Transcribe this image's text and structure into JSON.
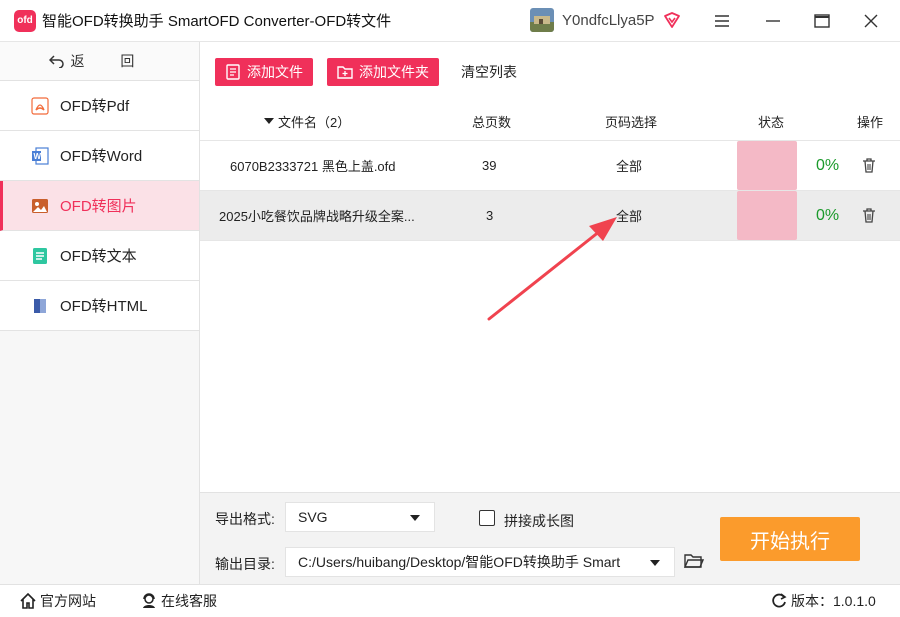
{
  "window": {
    "title": "智能OFD转换助手 SmartOFD Converter-OFD转文件",
    "logo_text": "ofd",
    "username": "Y0ndfcLlya5P"
  },
  "sidebar": {
    "back_label": "返 回",
    "items": [
      {
        "label": "OFD转Pdf",
        "icon": "pdf-icon"
      },
      {
        "label": "OFD转Word",
        "icon": "word-icon"
      },
      {
        "label": "OFD转图片",
        "icon": "image-icon",
        "active": true
      },
      {
        "label": "OFD转文本",
        "icon": "text-icon"
      },
      {
        "label": "OFD转HTML",
        "icon": "html-icon"
      }
    ]
  },
  "toolbar": {
    "add_file": "添加文件",
    "add_folder": "添加文件夹",
    "clear_list": "清空列表"
  },
  "table": {
    "headers": {
      "filename": "文件名（2）",
      "pages": "总页数",
      "range": "页码选择",
      "status": "状态",
      "action": "操作"
    },
    "rows": [
      {
        "filename": "6070B2333721 黑色上盖.ofd",
        "pages": "39",
        "range": "全部",
        "progress": "0%"
      },
      {
        "filename": "2025小吃餐饮品牌战略升级全案...",
        "pages": "3",
        "range": "全部",
        "progress": "0%"
      }
    ]
  },
  "bottom": {
    "format_label": "导出格式:",
    "format_value": "SVG",
    "merge_label": "拼接成长图",
    "output_label": "输出目录:",
    "output_value": "C:/Users/huibang/Desktop/智能OFD转换助手 Smart",
    "start_label": "开始执行"
  },
  "statusbar": {
    "website": "官方网站",
    "support": "在线客服",
    "version": "版本：1.0.1.0"
  },
  "colors": {
    "accent": "#f0305a",
    "start": "#fb9b2c",
    "progress_text": "#1a9a2a"
  }
}
